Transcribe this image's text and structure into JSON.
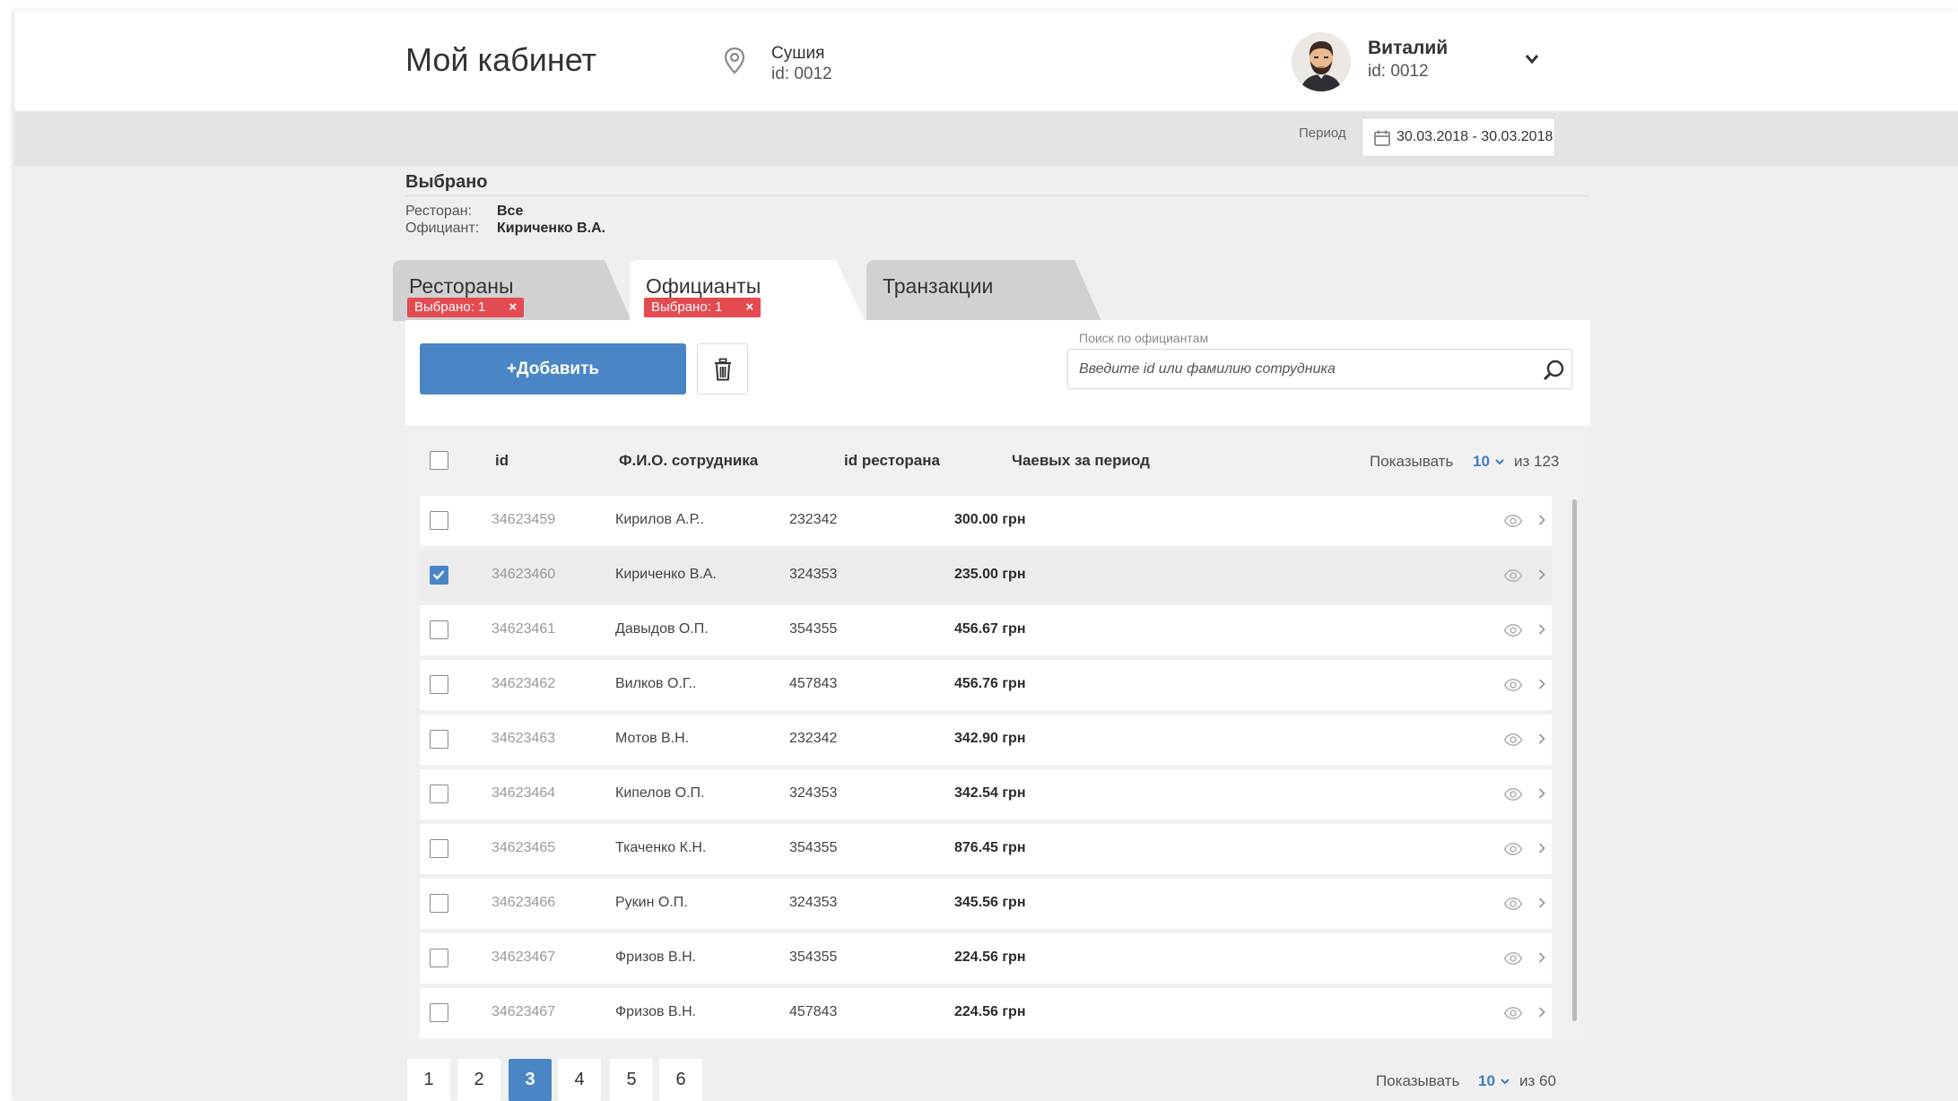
{
  "header": {
    "title": "Мой кабинет",
    "location": {
      "name": "Сушия",
      "id": "id: 0012"
    },
    "user": {
      "name": "Виталий",
      "id": "id: 0012"
    }
  },
  "period": {
    "label": "Период",
    "value": "30.03.2018 - 30.03.2018"
  },
  "selected": {
    "heading": "Выбрано",
    "restaurant_label": "Ресторан:",
    "restaurant_value": "Все",
    "waiter_label": "Официант:",
    "waiter_value": "Кириченко В.А."
  },
  "tabs": [
    {
      "label": "Рестораны",
      "badge": "Выбрано: 1",
      "badge_close": "×"
    },
    {
      "label": "Официанты",
      "badge": "Выбрано: 1",
      "badge_close": "×"
    },
    {
      "label": "Транзакции"
    }
  ],
  "toolbar": {
    "add_label": "+Добавить",
    "search_label": "Поиск по официантам",
    "search_placeholder": "Введите id или фамилию сотрудника",
    "search_value": ""
  },
  "table": {
    "columns": [
      "id",
      "Ф.И.О. сотрудника",
      "id ресторана",
      "Чаевых за период"
    ],
    "show_label": "Показывать",
    "show_value": "10",
    "show_of": "из 123",
    "rows": [
      {
        "id": "34623459",
        "name": "Кирилов А.Р..",
        "restaurant": "232342",
        "tips": "300.00 грн",
        "checked": false
      },
      {
        "id": "34623460",
        "name": "Кириченко В.А.",
        "restaurant": "324353",
        "tips": "235.00 грн",
        "checked": true
      },
      {
        "id": "34623461",
        "name": "Давыдов О.П.",
        "restaurant": "354355",
        "tips": "456.67 грн",
        "checked": false
      },
      {
        "id": "34623462",
        "name": "Вилков О.Г..",
        "restaurant": "457843",
        "tips": "456.76 грн",
        "checked": false
      },
      {
        "id": "34623463",
        "name": "Мотов В.Н.",
        "restaurant": "232342",
        "tips": "342.90 грн",
        "checked": false
      },
      {
        "id": "34623464",
        "name": "Кипелов О.П.",
        "restaurant": "324353",
        "tips": "342.54 грн",
        "checked": false
      },
      {
        "id": "34623465",
        "name": "Ткаченко К.Н.",
        "restaurant": "354355",
        "tips": "876.45 грн",
        "checked": false
      },
      {
        "id": "34623466",
        "name": "Рукин О.П.",
        "restaurant": "324353",
        "tips": "345.56 грн",
        "checked": false
      },
      {
        "id": "34623467",
        "name": "Фризов В.Н.",
        "restaurant": "354355",
        "tips": "224.56 грн",
        "checked": false
      },
      {
        "id": "34623467",
        "name": "Фризов В.Н.",
        "restaurant": "457843",
        "tips": "224.56 грн",
        "checked": false
      }
    ]
  },
  "pagination": {
    "pages": [
      "1",
      "2",
      "3",
      "4",
      "5",
      "6"
    ],
    "active": "3",
    "show_label": "Показывать",
    "show_value": "10",
    "show_of": "из 60"
  },
  "colors": {
    "accent": "#4a86c6",
    "badge": "#e34b51",
    "background": "#efefef"
  },
  "icons": [
    "location-pin-icon",
    "avatar",
    "chevron-down-icon",
    "calendar-icon",
    "trash-icon",
    "search-icon",
    "eye-icon",
    "chevron-right-icon"
  ]
}
